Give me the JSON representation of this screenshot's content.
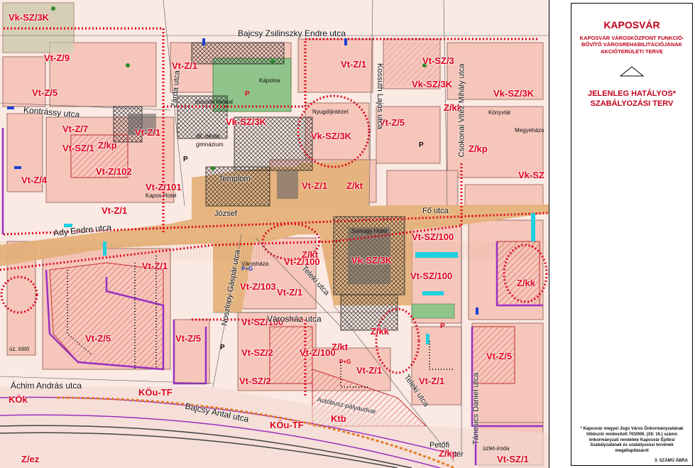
{
  "legend": {
    "title": "KAPOSVÁR",
    "subtitle": "KAPOSVÁR VÁROSKÖZPONT FUNKCIÓ-BŐVÍTŐ VÁROSREHABILITÁCIÓJÁNAK AKCIÓTERÜLETI TERVE",
    "plan_line1": "JELENLEG HATÁLYOS*",
    "plan_line2": "SZABÁLYOZÁSI TERV",
    "footnote": "* Kaposvár megyei Jogú Város Önkormányzatának többször módosított 70/2006. (XII. 16.) számú önkormányzati rendelete Kaposvár Építési Szabályzatának és szabályozási tervének megállapításáról",
    "figure_label": "3. SZÁMÚ ÁBRA",
    "arrow_icon": "north-arrow-icon"
  },
  "zones": [
    {
      "id": "vk-sz-3k-a",
      "text": "Vk-SZ/3K"
    },
    {
      "id": "vt-z-9",
      "text": "Vt-Z/9"
    },
    {
      "id": "vt-z-5-a",
      "text": "Vt-Z/5"
    },
    {
      "id": "vt-z-1-a",
      "text": "Vt-Z/1"
    },
    {
      "id": "vt-z-1-b",
      "text": "Vt-Z/1"
    },
    {
      "id": "vt-sz-3-a",
      "text": "Vt-SZ/3"
    },
    {
      "id": "vk-sz-3k-b",
      "text": "Vk-SZ/3K"
    },
    {
      "id": "vk-sz-3k-c",
      "text": "Vk-SZ/3K"
    },
    {
      "id": "vk-sz-3k-d",
      "text": "Vk-SZ/3K"
    },
    {
      "id": "vk-sz-3k-e",
      "text": "Vk-SZ/3K"
    },
    {
      "id": "z-kk-a",
      "text": "Z/kk"
    },
    {
      "id": "vt-z-7",
      "text": "Vt-Z/7"
    },
    {
      "id": "vt-z-1-c",
      "text": "Vt-Z/1"
    },
    {
      "id": "vt-sz-1",
      "text": "Vt-SZ/1"
    },
    {
      "id": "z-kp-a",
      "text": "Z/kp"
    },
    {
      "id": "vt-z-5-b",
      "text": "Vt-Z/5"
    },
    {
      "id": "z-kp-b",
      "text": "Z/kp"
    },
    {
      "id": "vk-sz-a",
      "text": "Vk-SZ"
    },
    {
      "id": "vt-z-4",
      "text": "Vt-Z/4"
    },
    {
      "id": "vt-z-102",
      "text": "Vt-Z/102"
    },
    {
      "id": "vt-z-101",
      "text": "Vt-Z/101"
    },
    {
      "id": "vt-z-1-d",
      "text": "Vt-Z/1"
    },
    {
      "id": "vt-z-1-e",
      "text": "Vt-Z/1"
    },
    {
      "id": "z-kt-a",
      "text": "Z/kt"
    },
    {
      "id": "vt-sz-100-a",
      "text": "Vt-SZ/100"
    },
    {
      "id": "z-kt-b",
      "text": "Z/kt"
    },
    {
      "id": "vt-z-100-a",
      "text": "Vt-Z/100"
    },
    {
      "id": "vk-sz-3k-f",
      "text": "Vk-SZ/3K"
    },
    {
      "id": "vt-sz-100-b",
      "text": "Vt-SZ/100"
    },
    {
      "id": "z-kk-b",
      "text": "Z/kk"
    },
    {
      "id": "vt-z-1-f",
      "text": "Vt-Z/1"
    },
    {
      "id": "vt-z-103",
      "text": "Vt-Z/103"
    },
    {
      "id": "vt-z-1-g",
      "text": "Vt-Z/1"
    },
    {
      "id": "vt-sz-100-c",
      "text": "Vt-SZ/100"
    },
    {
      "id": "z-kk-c",
      "text": "Z/kk"
    },
    {
      "id": "vt-z-5-c",
      "text": "Vt-Z/5"
    },
    {
      "id": "vt-z-5-d",
      "text": "Vt-Z/5"
    },
    {
      "id": "vt-sz-2-a",
      "text": "Vt-SZ/2"
    },
    {
      "id": "vt-z-100-b",
      "text": "Vt-Z/100"
    },
    {
      "id": "z-kt-c",
      "text": "Z/kt"
    },
    {
      "id": "vt-z-1-h",
      "text": "Vt-Z/1"
    },
    {
      "id": "vt-z-5-e",
      "text": "Vt-Z/5"
    },
    {
      "id": "vt-sz-2-b",
      "text": "Vt-SZ/2"
    },
    {
      "id": "vt-z-1-i",
      "text": "Vt-Z/1"
    },
    {
      "id": "kou-tf-a",
      "text": "KÖu-TF"
    },
    {
      "id": "kou-tf-b",
      "text": "KÖu-TF"
    },
    {
      "id": "kok",
      "text": "KÖk"
    },
    {
      "id": "ktb",
      "text": "Ktb"
    },
    {
      "id": "z-kp-c",
      "text": "Z/kp"
    },
    {
      "id": "vt-sz-1-b",
      "text": "Vt-SZ/1"
    },
    {
      "id": "z-ez",
      "text": "Z/ez"
    }
  ],
  "streets": [
    {
      "id": "bajcsy",
      "text": "Bajcsy Zsilinszky Endre utca"
    },
    {
      "id": "kontrassy",
      "text": "Kontrássy utca"
    },
    {
      "id": "zarda",
      "text": "Zárda utca"
    },
    {
      "id": "kossuth",
      "text": "Kossuth Lajos utca"
    },
    {
      "id": "csokonai",
      "text": "Csokonai Vitéz Mihály utca"
    },
    {
      "id": "ady",
      "text": "Ady Endre utca"
    },
    {
      "id": "templom",
      "text": "Templom"
    },
    {
      "id": "noszlopy",
      "text": "Noszlopy Gáspár utca"
    },
    {
      "id": "varoshaz",
      "text": "Városház utca"
    },
    {
      "id": "teleki-a",
      "text": "Teleki utca"
    },
    {
      "id": "teleki-b",
      "text": "Teleki utca"
    },
    {
      "id": "fo",
      "text": "Fő utca"
    },
    {
      "id": "jozsef",
      "text": "József"
    },
    {
      "id": "achim",
      "text": "Áchim András utca"
    },
    {
      "id": "bajcsy2",
      "text": "Bajcsy Antal utca"
    },
    {
      "id": "tancsics",
      "text": "Táncsics Dániel utca"
    },
    {
      "id": "autobusz",
      "text": "Autóbusz-pályaudvar"
    },
    {
      "id": "petofi",
      "text": "Petőfi"
    },
    {
      "id": "ter",
      "text": "tér"
    }
  ],
  "small_labels": [
    {
      "id": "nyugdijintezet",
      "text": "Nyugdíjintézet"
    },
    {
      "id": "puspoki-hivatal",
      "text": "püspöki hivatal"
    },
    {
      "id": "iskola",
      "text": "ált. iskola"
    },
    {
      "id": "gimnazium",
      "text": "gimnázium"
    },
    {
      "id": "kapos-hotel",
      "text": "Kapos Hotel"
    },
    {
      "id": "konyvtar",
      "text": "Könyvtár"
    },
    {
      "id": "megyehaza",
      "text": "Megyeháza"
    },
    {
      "id": "ebetoltes",
      "text": "üz. töltő"
    },
    {
      "id": "uzlet-iroda",
      "text": "üzlet-iroda"
    },
    {
      "id": "kapolna",
      "text": "Kápolna"
    },
    {
      "id": "varoshaza",
      "text": "Városháza"
    },
    {
      "id": "somogyi-hotel",
      "text": "Somogy Hotel"
    }
  ],
  "symbols": [
    {
      "id": "p-1",
      "text": "P"
    },
    {
      "id": "p-2",
      "text": "P"
    },
    {
      "id": "p-3",
      "text": "P"
    },
    {
      "id": "p-4",
      "text": "P"
    },
    {
      "id": "p-5",
      "text": "P"
    },
    {
      "id": "pg-1",
      "text": "P+G"
    },
    {
      "id": "pg-2",
      "text": "P+G"
    }
  ],
  "colors": {
    "zone_red": "#e0001a",
    "block_pink": "#f6c6bb",
    "street_orange": "#e5b27a",
    "park_green": "#8fc48a",
    "boundary_purple": "#9a2fc0",
    "water_cyan": "#21d0e0",
    "rail_dotted": "#e37a25"
  }
}
